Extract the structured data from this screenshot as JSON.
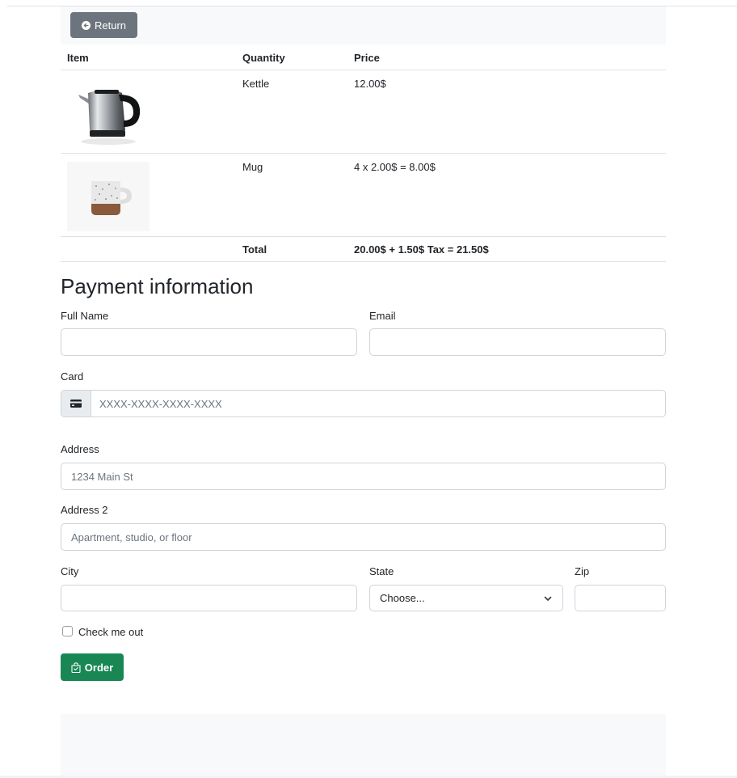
{
  "header": {
    "return_label": "Return"
  },
  "cart": {
    "columns": [
      "Item",
      "Quantity",
      "Price"
    ],
    "rows": [
      {
        "image": "kettle-image",
        "quantity": "Kettle",
        "price": "12.00$"
      },
      {
        "image": "mug-image",
        "quantity": "Mug",
        "price": "4 x 2.00$ = 8.00$"
      }
    ],
    "total_label": "Total",
    "total_value": "20.00$ + 1.50$ Tax = 21.50$"
  },
  "payment": {
    "title": "Payment information",
    "full_name_label": "Full Name",
    "email_label": "Email",
    "card_label": "Card",
    "card_placeholder": "XXXX-XXXX-XXXX-XXXX",
    "card_icon": "credit-card-icon",
    "address_label": "Address",
    "address_placeholder": "1234 Main St",
    "address2_label": "Address 2",
    "address2_placeholder": "Apartment, studio, or floor",
    "city_label": "City",
    "state_label": "State",
    "state_selected": "Choose...",
    "zip_label": "Zip",
    "checkbox_label": "Check me out",
    "order_label": "Order",
    "order_icon": "bag-check-icon"
  },
  "colors": {
    "secondary": "#6c757d",
    "success": "#198754",
    "light_bg": "#f8f9fa",
    "border": "#dee2e6"
  }
}
